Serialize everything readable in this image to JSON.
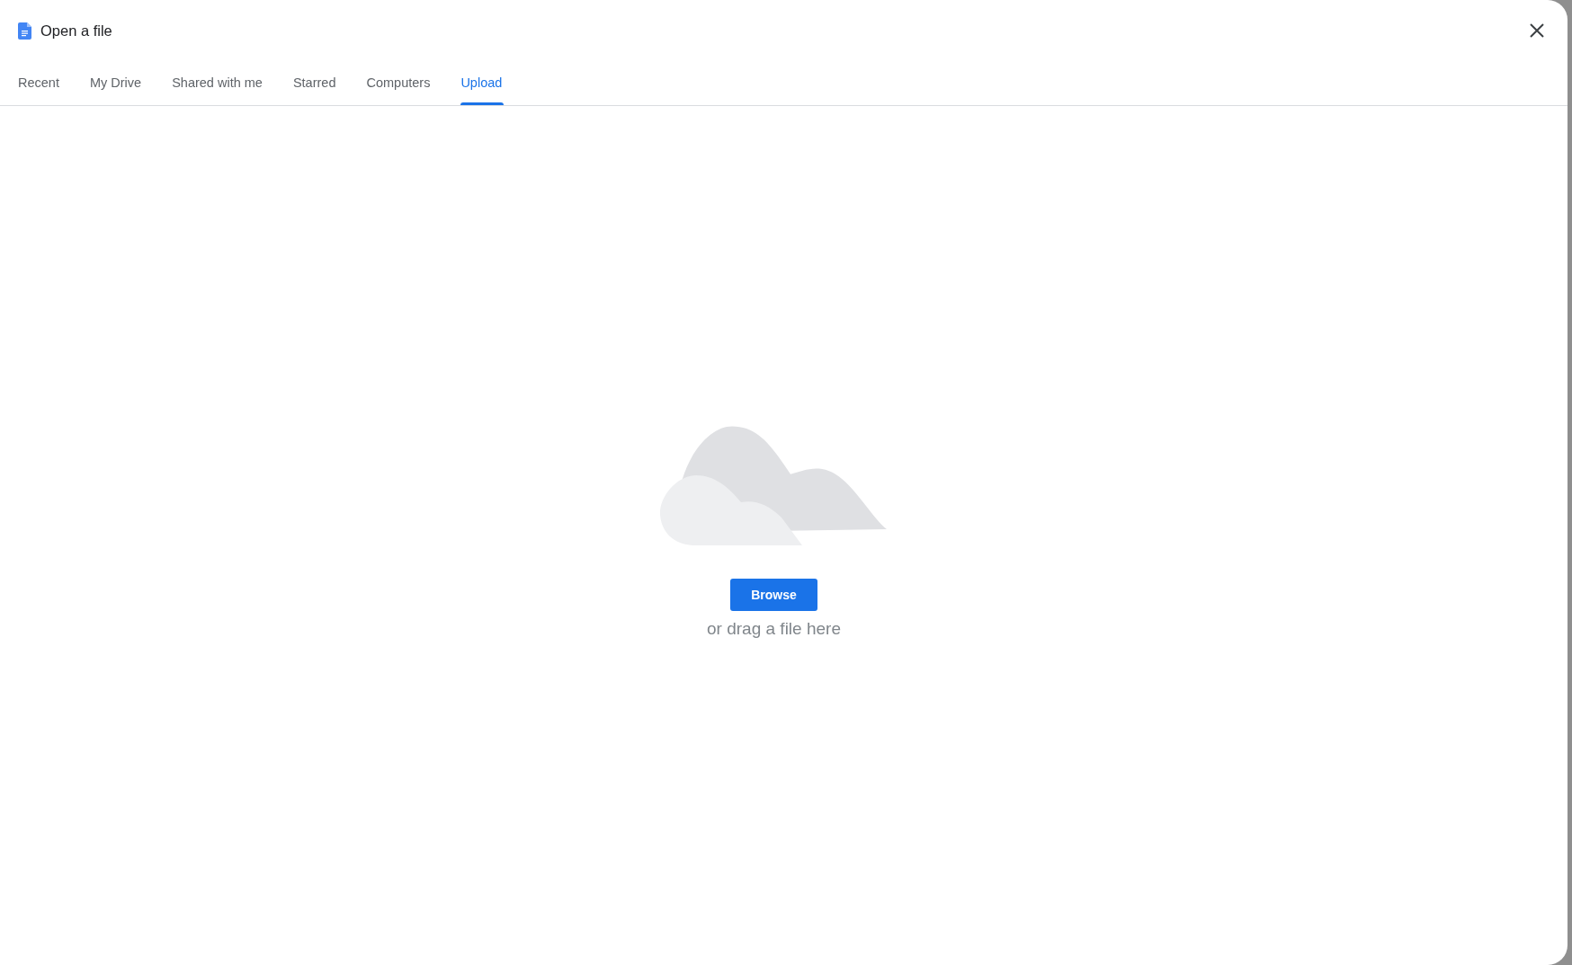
{
  "dialog": {
    "title": "Open a file"
  },
  "tabs": [
    {
      "label": "Recent",
      "selected": false
    },
    {
      "label": "My Drive",
      "selected": false
    },
    {
      "label": "Shared with me",
      "selected": false
    },
    {
      "label": "Starred",
      "selected": false
    },
    {
      "label": "Computers",
      "selected": false
    },
    {
      "label": "Upload",
      "selected": true
    }
  ],
  "upload": {
    "button": "Browse",
    "hint": "or drag a file here"
  }
}
